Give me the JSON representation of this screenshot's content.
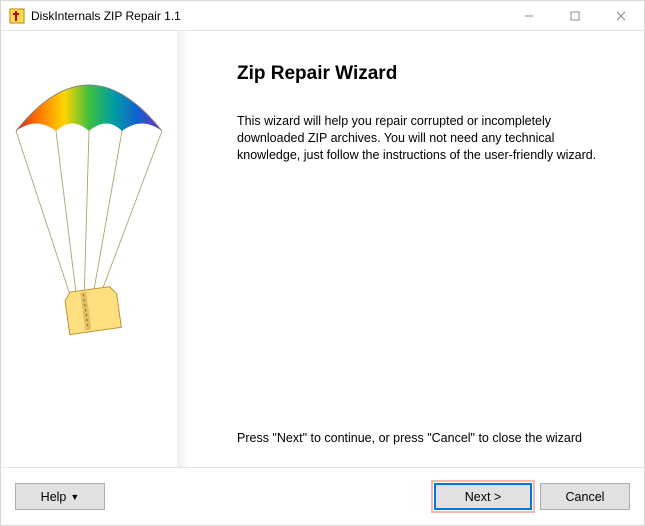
{
  "window": {
    "title": "DiskInternals ZIP Repair 1.1"
  },
  "main": {
    "heading": "Zip Repair Wizard",
    "body": "This wizard will help you repair corrupted or incompletely downloaded ZIP archives. You will not need any technical knowledge, just follow the instructions of the user-friendly wizard.",
    "hint": "Press \"Next\" to continue, or press \"Cancel\" to close the wizard"
  },
  "buttons": {
    "help": "Help",
    "next": "Next >",
    "cancel": "Cancel"
  }
}
